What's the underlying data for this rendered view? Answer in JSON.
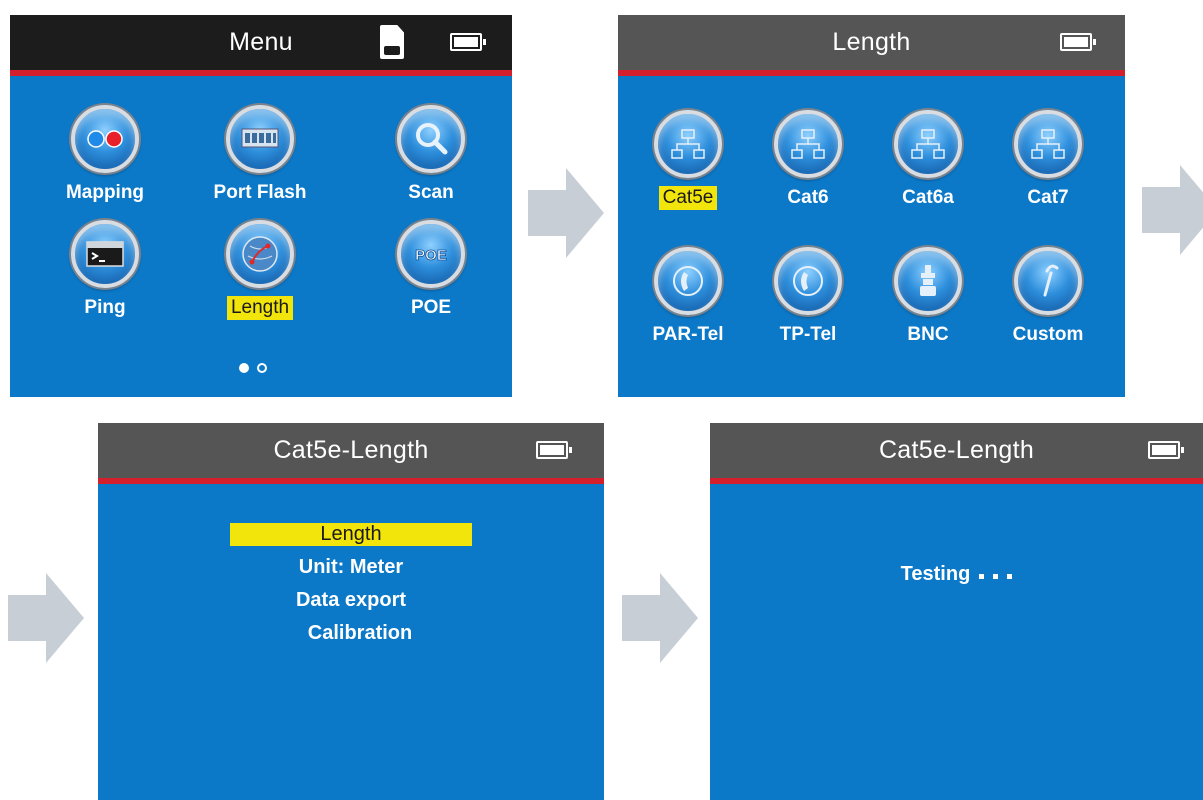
{
  "menu_screen": {
    "title": "Menu",
    "apps": [
      {
        "label": "Mapping",
        "icon": "mapping-icon",
        "selected": false
      },
      {
        "label": "Port Flash",
        "icon": "port-flash-icon",
        "selected": false
      },
      {
        "label": "Scan",
        "icon": "magnifier-icon",
        "selected": false
      },
      {
        "label": "Ping",
        "icon": "terminal-icon",
        "selected": false
      },
      {
        "label": "Length",
        "icon": "globe-icon",
        "selected": true
      },
      {
        "label": "POE",
        "icon": "poe-icon",
        "selected": false
      }
    ],
    "page_dots": {
      "count": 2,
      "active": 1
    }
  },
  "length_screen": {
    "title": "Length",
    "apps": [
      {
        "label": "Cat5e",
        "icon": "network-topology-icon",
        "selected": true
      },
      {
        "label": "Cat6",
        "icon": "network-topology-icon",
        "selected": false
      },
      {
        "label": "Cat6a",
        "icon": "network-topology-icon",
        "selected": false
      },
      {
        "label": "Cat7",
        "icon": "network-topology-icon",
        "selected": false
      },
      {
        "label": "PAR-Tel",
        "icon": "phone-icon",
        "selected": false
      },
      {
        "label": "TP-Tel",
        "icon": "phone-icon",
        "selected": false
      },
      {
        "label": "BNC",
        "icon": "bnc-connector-icon",
        "selected": false
      },
      {
        "label": "Custom",
        "icon": "wrench-icon",
        "selected": false
      }
    ]
  },
  "options_screen": {
    "title": "Cat5e-Length",
    "items": [
      {
        "label": "Length",
        "selected": true
      },
      {
        "label": "Unit: Meter",
        "selected": false
      },
      {
        "label": "Data export",
        "selected": false
      },
      {
        "label": "Calibration",
        "selected": false
      }
    ]
  },
  "testing_screen": {
    "title": "Cat5e-Length",
    "status": "Testing"
  },
  "colors": {
    "screen_bg": "#0b78c8",
    "titlebar_dark": "#1c1c1c",
    "titlebar_grey": "#555555",
    "accent_red": "#d3202c",
    "highlight_yellow": "#f1e50b",
    "arrow_grey": "#c7ced6"
  }
}
